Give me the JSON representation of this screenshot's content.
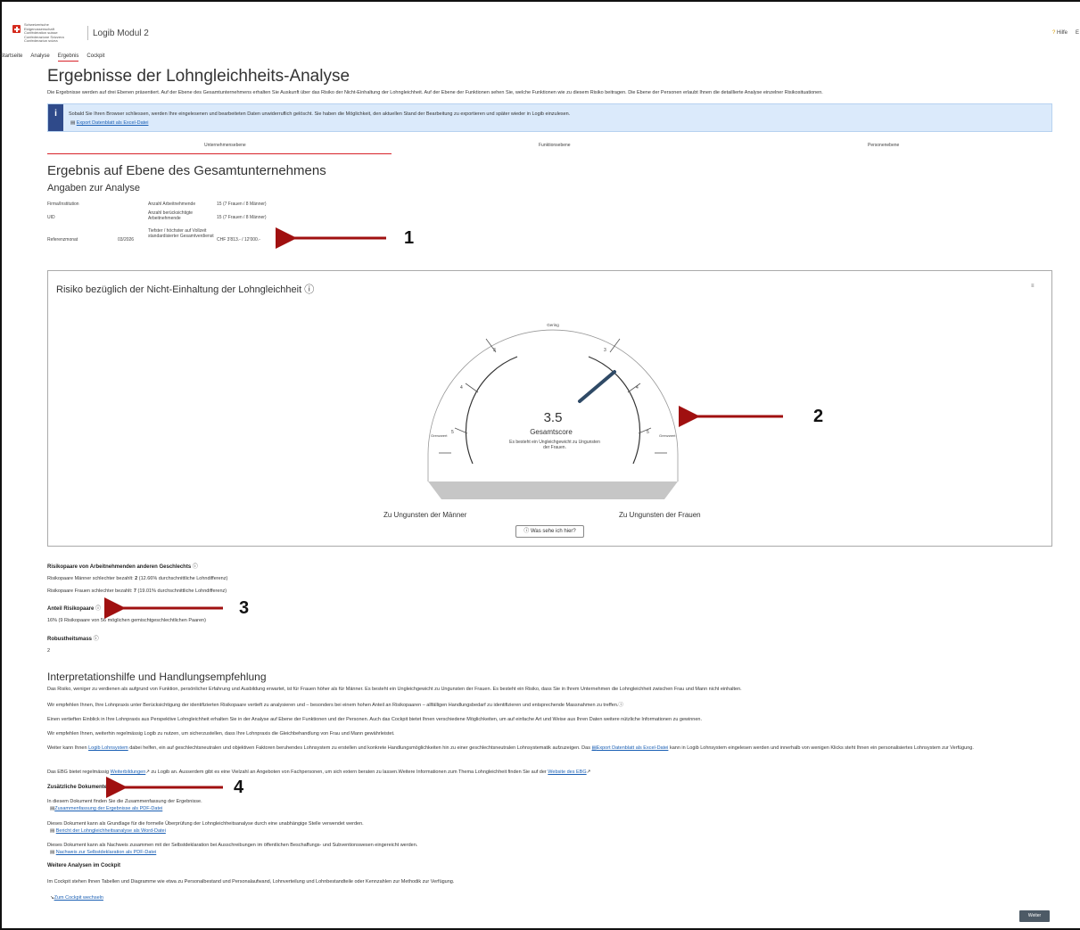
{
  "header": {
    "federal_lines": [
      "Schweizerische Eidgenossenschaft",
      "Confédération suisse",
      "Confederazione Svizzera",
      "Confederaziun svizra"
    ],
    "app_title": "Logib Modul 2",
    "help_label": "Hilfe",
    "edge_label": "E"
  },
  "nav": {
    "items": [
      "Startseite",
      "Analyse",
      "Ergebnis",
      "Cockpit"
    ],
    "active": "Ergebnis"
  },
  "page": {
    "title": "Ergebnisse der Lohngleichheits-Analyse",
    "intro": "Die Ergebnisse werden auf drei Ebenen präsentiert. Auf der Ebene des Gesamtunternehmens erhalten Sie Auskunft über das Risiko der Nicht-Einhaltung der Lohngleichheit. Auf der Ebene der Funktionen sehen Sie, welche Funktionen wie zu diesem Risiko beitragen. Die Ebene der Personen erlaubt Ihnen die detaillierte Analyse einzelner Risikosituationen."
  },
  "info_box": {
    "icon": "i",
    "text": "Sobald Sie Ihren Browser schliessen, werden Ihre eingelesenen und bearbeiteten Daten unwiderruflich gelöscht. Sie haben die Möglichkeit, den aktuellen Stand der Bearbeitung zu exportieren und später wieder in Logib einzulesen.",
    "link": "Export Datenblatt als Excel-Datei"
  },
  "level_tabs": [
    "Unternehmensebene",
    "Funktionsebene",
    "Personenebene"
  ],
  "section": {
    "title": "Ergebnis auf Ebene des Gesamtunternehmens",
    "subtitle": "Angaben zur Analyse"
  },
  "analysis_info": {
    "firm_label": "Firma/Institution",
    "uid_label": "UID",
    "ref_month_label": "Referenzmonat",
    "ref_month_value": "03/2026",
    "employees_label": "Anzahl Arbeitnehmende",
    "employees_value": "15 (7 Frauen / 8 Männer)",
    "considered_label": "Anzahl berücksichtigte Arbeitnehmende",
    "considered_value": "15 (7 Frauen / 8 Männer)",
    "earnings_label": "Tiefster / höchster auf Vollzeit standardisierter Gesamtverdienst",
    "earnings_value": "CHF 3'813.- / 12'000.-"
  },
  "gauge": {
    "title": "Risiko bezüglich der Nicht-Einhaltung der Lohngleichheit",
    "info_icon": "ⓘ",
    "corner_icon": "≡",
    "score": "3.5",
    "score_value": 3.5,
    "score_label": "Gesamtscore",
    "description": "Es besteht ein Ungleichgewicht zu Ungunsten der Frauen.",
    "top_label": "Gering",
    "left_limit_label": "Grenzwert",
    "right_limit_label": "Grenzwert",
    "tick_labels": [
      "5",
      "4",
      "3",
      "3",
      "4",
      "5"
    ],
    "left_side": "Zu Ungunsten der Männer",
    "right_side": "Zu Ungunsten der Frauen",
    "help_button": "Was sehe ich hier?"
  },
  "risk_pairs": {
    "title": "Risikopaare von Arbeitnehmenden anderen Geschlechts",
    "men_line_prefix": "Risikopaare Männer schlechter bezahlt:",
    "men_count": "2",
    "men_detail": "(12.66% durchschnittliche Lohndifferenz)",
    "women_line_prefix": "Risikopaare Frauen schlechter bezahlt:",
    "women_count": "7",
    "women_detail": "(19.01% durchschnittliche Lohndifferenz)",
    "share_title": "Anteil Risikopaare",
    "share_text": "16% (9 Risikopaare von 56 möglichen gemischtgeschlechtlichen Paaren)",
    "robust_title": "Robustheitsmass",
    "robust_value": "2"
  },
  "interpretation": {
    "title": "Interpretationshilfe und Handlungsempfehlung",
    "p1": "Das Risiko, weniger zu verdienen als aufgrund von Funktion, persönlicher Erfahrung und Ausbildung erwartet, ist für Frauen höher als für Männer. Es besteht ein Ungleichgewicht zu Ungunsten der Frauen. Es besteht ein Risiko, dass Sie in Ihrem Unternehmen die Lohngleichheit zwischen Frau und Mann nicht einhalten.",
    "p2": "Wir empfehlen Ihnen, Ihre Lohnpraxis unter Berücksichtigung der identifizierten Risikopaare vertieft zu analysieren und – besonders bei einem hohen Anteil an Risikopaaren – allfälligen Handlungsbedarf zu identifizieren und entsprechende Massnahmen zu treffen.ⓘ",
    "p3": "Einen vertieften Einblick in Ihre Lohnpraxis aus Perspektive Lohngleichheit erhalten Sie in der Analyse auf Ebene der Funktionen und der Personen. Auch das Cockpit bietet Ihnen verschiedene Möglichkeiten, um auf einfache Art und Weise aus Ihren Daten weitere nützliche Informationen zu gewinnen.",
    "p4": "Wir empfehlen Ihnen, weiterhin regelmässig Logib zu nutzen, um sicherzustellen, dass Ihre Lohnpraxis die Gleichbehandlung von Frau und Mann gewährleistet.",
    "p5_a": "Weiter kann Ihnen",
    "p5_link1": "Logib Lohnsystem",
    "p5_b": "dabei helfen, ein auf geschlechtsneutralen und objektiven Faktoren beruhendes Lohnsystem zu erstellen und konkrete Handlungsmöglichkeiten hin zu einer geschlechtsneutralen Lohnsystematik aufzuzeigen. Das",
    "p5_link2": "Export Datenblatt als Excel-Datei",
    "p5_c": "kann in Logib Lohnsystem eingelesen werden und innerhalb von wenigen Klicks steht Ihnen ein",
    "p5_d": "personalisiertes Lohnsystem zur Verfügung.",
    "p6_a": "Das EBG bietet regelmässig",
    "p6_link1": "Weiterbildungen",
    "p6_b": "zu Logib an. Ausserdem gibt es eine Vielzahl an Angeboten von Fachpersonen, um sich extern beraten zu lassen.Weitere Informationen zum Thema Lohngleichheit finden Sie auf der",
    "p6_link2": "Website des EBG"
  },
  "documents": {
    "title": "Zusätzliche Dokumente",
    "d1_text": "In diesem Dokument finden Sie die Zusammenfassung der Ergebnisse.",
    "d1_link": "Zusammenfassung der Ergebnisse als PDF-Datei",
    "d2_text": "Dieses Dokument kann als Grundlage für die formelle Überprüfung der Lohngleichheitsanalyse durch eine unabhängige Stelle verwendet werden.",
    "d2_link": "Bericht der Lohngleichheitsanalyse als Word-Datei",
    "d3_text": "Dieses Dokument kann als Nachweis zusammen mit der Selbstdeklaration bei Ausschreibungen im öffentlichen Beschaffungs- und Subventionswesen eingereicht werden.",
    "d3_link": "Nachweis zur Selbstdeklaration als PDF-Datei"
  },
  "cockpit": {
    "title": "Weitere Analysen im Cockpit",
    "text": "Im Cockpit stehen Ihnen Tabellen und Diagramme wie etwa zu Personalbestand und Personalaufwand, Lohnverteilung und Lohnbestandteile oder Kennzahlen zur Methodik zur Verfügung.",
    "link": "Zum Cockpit wechseln"
  },
  "next_button": "Weiter",
  "annotations": {
    "labels": [
      "1",
      "2",
      "3",
      "4"
    ],
    "color": "#a01010"
  },
  "colors": {
    "accent_red": "#d8232a",
    "info_bg": "#dbeafb",
    "info_icon_bg": "#2f4a8a",
    "link": "#1a5fb4",
    "needle": "#2f4a66"
  }
}
